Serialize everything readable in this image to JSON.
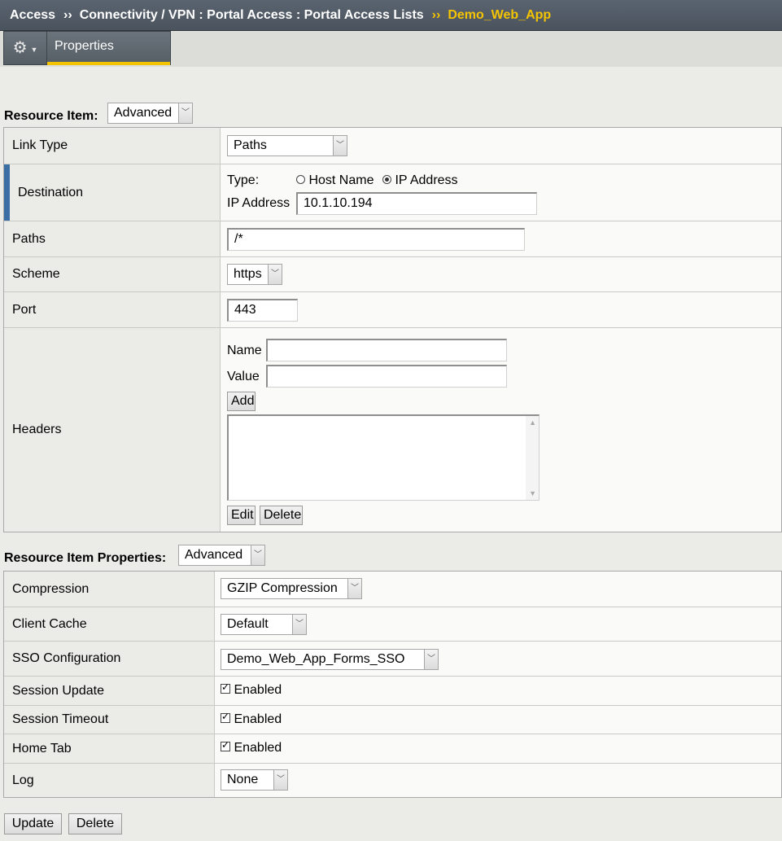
{
  "breadcrumb": {
    "items": [
      "Access",
      "Connectivity / VPN : Portal Access : Portal Access Lists"
    ],
    "separator": "››",
    "current": "Demo_Web_App"
  },
  "tabs": {
    "properties": "Properties"
  },
  "resource_item": {
    "label": "Resource Item:",
    "mode": "Advanced",
    "link_type": {
      "label": "Link Type",
      "value": "Paths"
    },
    "destination": {
      "label": "Destination",
      "type_label": "Type:",
      "option_host": "Host Name",
      "option_ip": "IP Address",
      "selected": "IP Address",
      "ip_label": "IP Address",
      "ip_value": "10.1.10.194"
    },
    "paths": {
      "label": "Paths",
      "value": "/*"
    },
    "scheme": {
      "label": "Scheme",
      "value": "https"
    },
    "port": {
      "label": "Port",
      "value": "443"
    },
    "headers": {
      "label": "Headers",
      "name_label": "Name",
      "name_value": "",
      "value_label": "Value",
      "value_value": "",
      "add": "Add",
      "edit": "Edit",
      "delete": "Delete"
    }
  },
  "resource_item_properties": {
    "label": "Resource Item Properties:",
    "mode": "Advanced",
    "compression": {
      "label": "Compression",
      "value": "GZIP Compression"
    },
    "client_cache": {
      "label": "Client Cache",
      "value": "Default"
    },
    "sso": {
      "label": "SSO Configuration",
      "value": "Demo_Web_App_Forms_SSO"
    },
    "session_update": {
      "label": "Session Update",
      "value": "Enabled",
      "checked": true
    },
    "session_timeout": {
      "label": "Session Timeout",
      "value": "Enabled",
      "checked": true
    },
    "home_tab": {
      "label": "Home Tab",
      "value": "Enabled",
      "checked": true
    },
    "log": {
      "label": "Log",
      "value": "None"
    }
  },
  "actions": {
    "update": "Update",
    "delete": "Delete"
  },
  "colors": {
    "accent": "#f5c400",
    "titlebar": "#505963",
    "destination_marker": "#3b6ea5"
  },
  "icons": {
    "gear": "gear-icon",
    "dropdown": "chevron-down-icon"
  }
}
